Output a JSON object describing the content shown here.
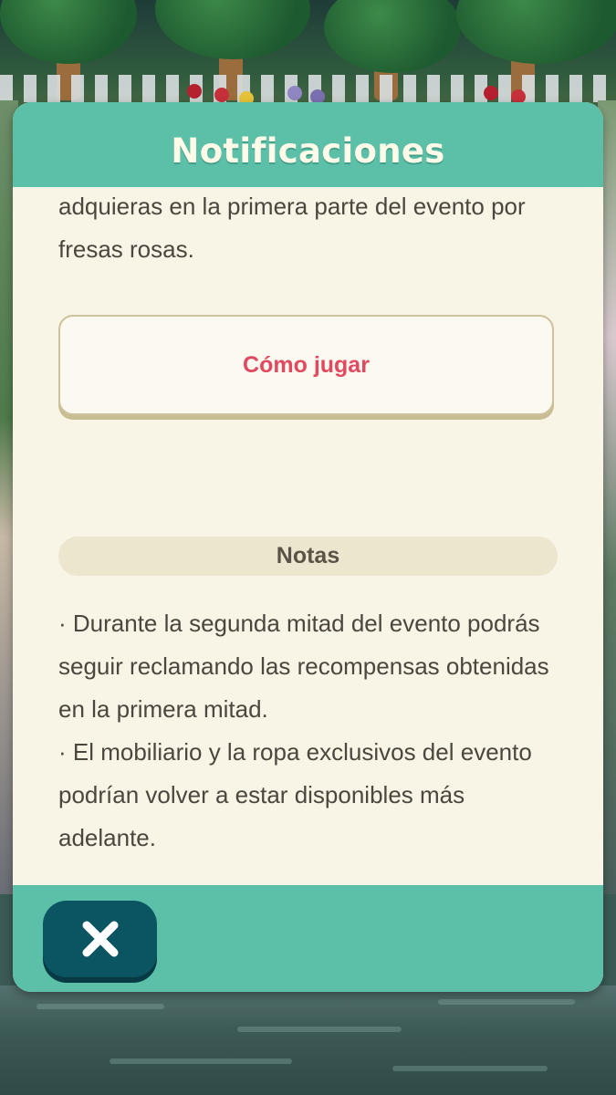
{
  "dialog": {
    "title": "Notificaciones",
    "intro_lines": [
      "adquieras en la primera parte del evento por",
      "fresas rosas."
    ],
    "how_to_play_label": "Cómo jugar",
    "notes_title": "Notas",
    "notes_lines": [
      "· Durante la segunda mitad del evento podrás",
      "seguir reclamando las recompensas obtenidas",
      "en la primera mitad.",
      "· El mobiliario y la ropa exclusivos del evento",
      "podrían volver a estar disponibles más",
      "adelante."
    ]
  },
  "footer": {
    "close_icon": "close-icon"
  },
  "colors": {
    "header_teal": "#5cc0a9",
    "panel_cream": "#f8f5e6",
    "accent_pink": "#e0495f",
    "close_button": "#0b5461",
    "text": "#4c463e"
  }
}
